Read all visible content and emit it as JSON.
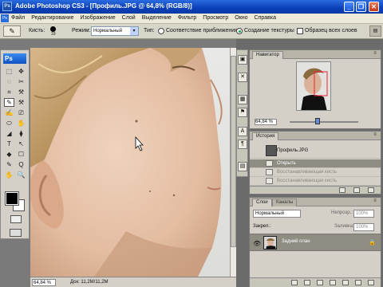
{
  "window": {
    "title": "Adobe Photoshop CS3 - [Профиль.JPG @ 64,8% (RGB/8)]",
    "minimize": "_",
    "restore": "❐",
    "close": "✕"
  },
  "menu": [
    "Файл",
    "Редактирование",
    "Изображение",
    "Слой",
    "Выделение",
    "Фильтр",
    "Просмотр",
    "Окно",
    "Справка"
  ],
  "options": {
    "brush_label": "Кисть:",
    "brush_size": "19",
    "mode_label": "Режим:",
    "mode_value": "Нормальный",
    "type_label": "Тип:",
    "type_option_1": "Соответствие приближения",
    "type_option_2": "Создание текстуры",
    "sample_all": "Образец всех слоев",
    "selected_type": "Создание текстуры"
  },
  "toolbox": {
    "logo": "Ps",
    "tools": [
      "⬚",
      "✥",
      "◌",
      "✂",
      "⌗",
      "⚒",
      "✎",
      "⚒",
      "✍",
      "⎚",
      "⬭",
      "✋",
      "◢",
      "⧫",
      "T",
      "↖",
      "◆",
      "☐",
      "✎",
      "Q",
      "✋",
      "🔍"
    ]
  },
  "status": {
    "zoom": "64,84 %",
    "doc": "Док: 11,2M/11,2M"
  },
  "navigator": {
    "tab": "Навигатор",
    "zoom": "64,84 %"
  },
  "history": {
    "tab": "История",
    "snapshot": "Профиль.JPG",
    "items": [
      {
        "label": "Открыть",
        "state": "active"
      },
      {
        "label": "Восстанавливающая кисть",
        "state": "dim"
      },
      {
        "label": "Восстанавливающая кисть",
        "state": "dim"
      }
    ]
  },
  "layers": {
    "tab_layers": "Слои",
    "tab_channels": "Каналы",
    "mode": "Нормальный",
    "opacity_label": "Непрозр.:",
    "opacity": "100%",
    "lock_label": "Закреп.:",
    "fill_label": "Заливка:",
    "fill": "100%",
    "layer_name": "Задний план"
  },
  "colors": {
    "titlebar": "#0a3fb8",
    "panel": "#d4d0c8",
    "workspace": "#7a7a7a",
    "selected_row": "#8f8c82"
  }
}
